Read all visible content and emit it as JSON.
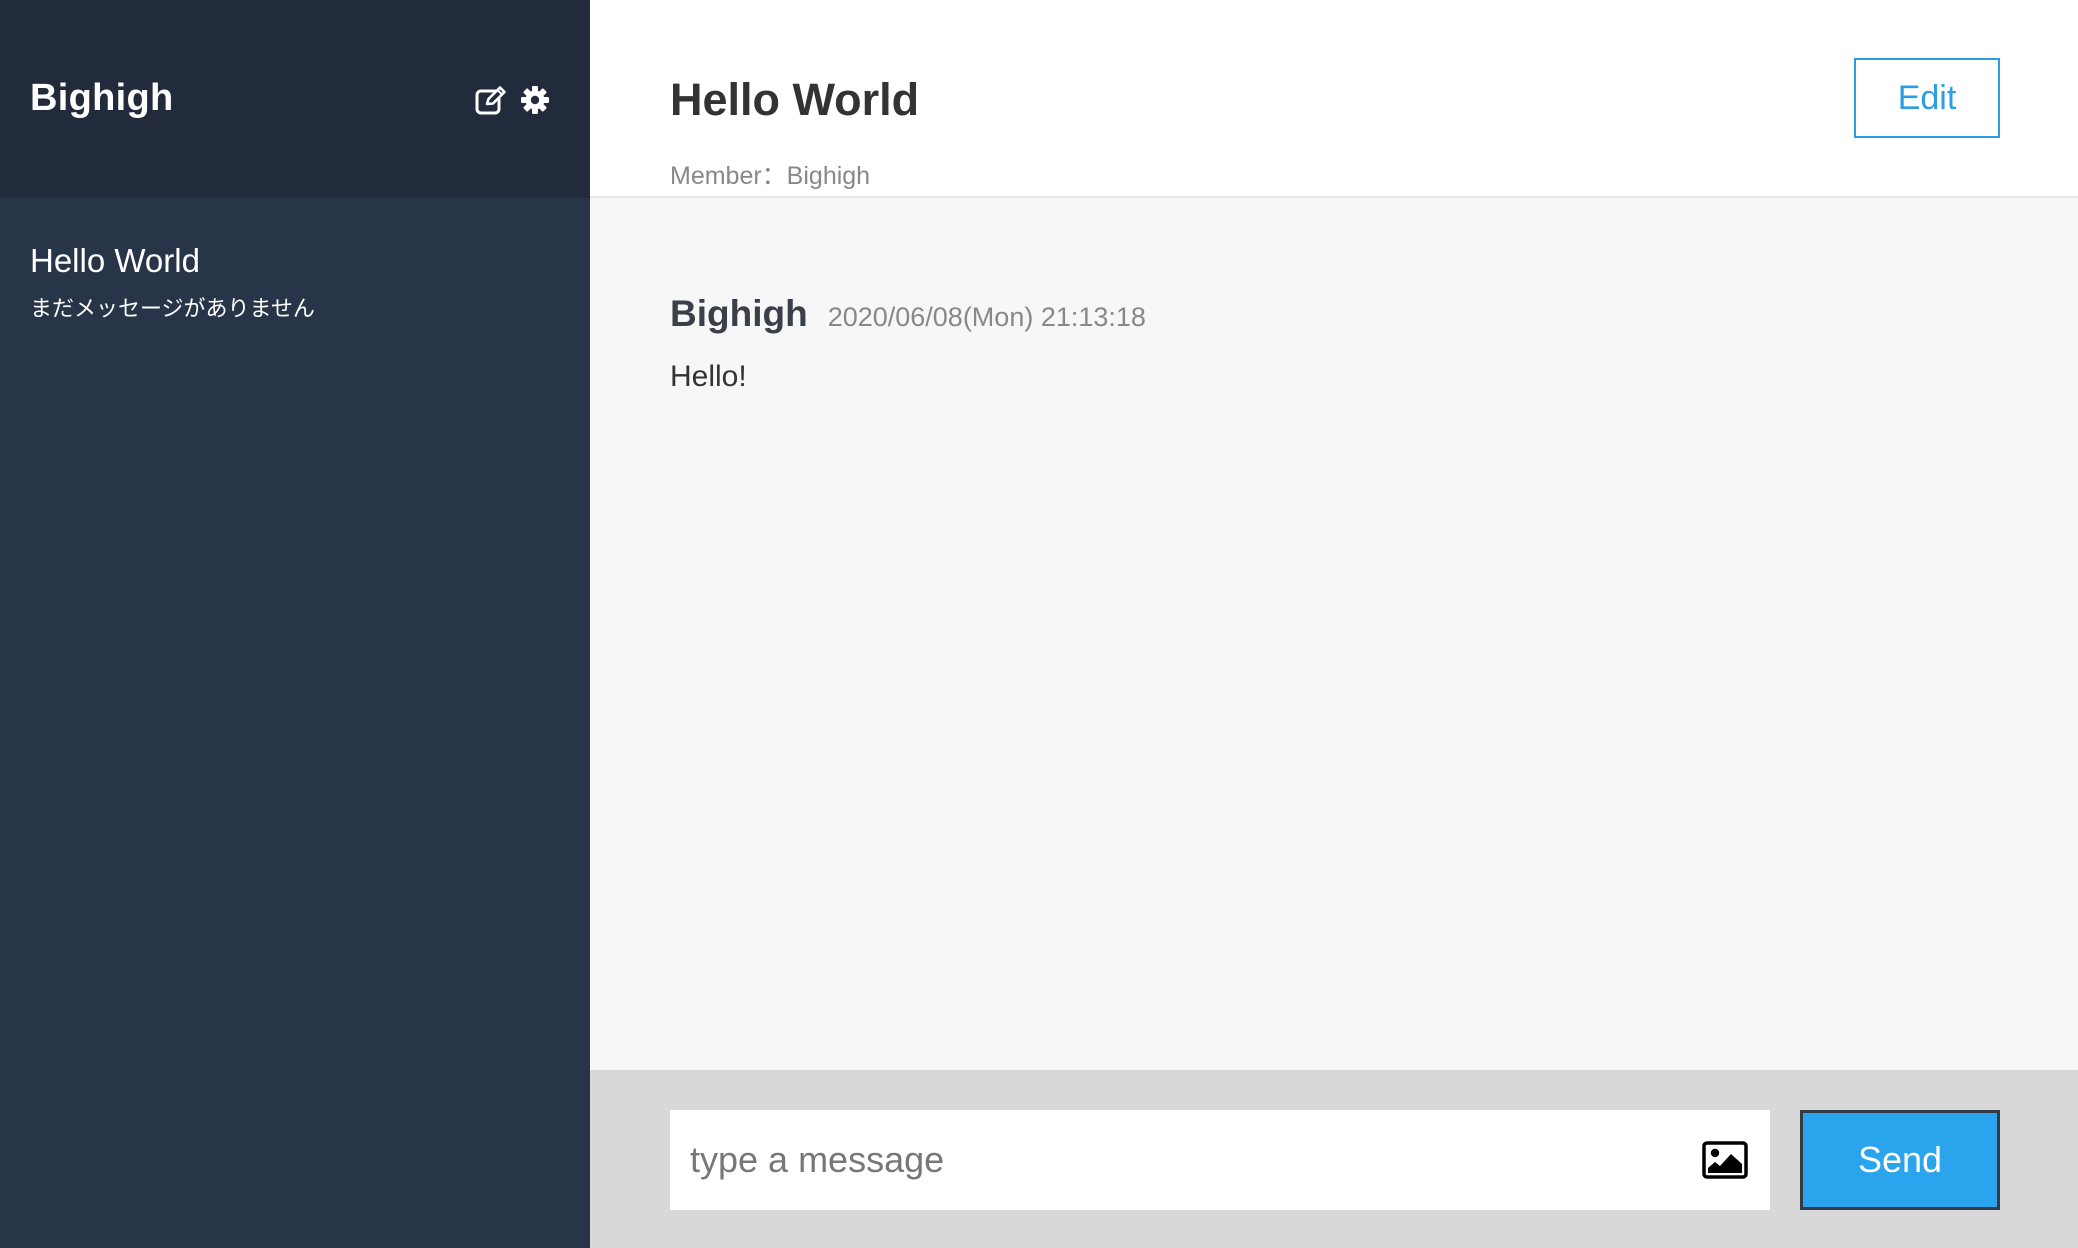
{
  "sidebar": {
    "user_name": "Bighigh",
    "icons": {
      "edit": "edit-icon",
      "settings": "gear-icon"
    },
    "rooms": [
      {
        "name": "Hello World",
        "preview": "まだメッセージがありません"
      }
    ]
  },
  "room": {
    "title": "Hello World",
    "members": "Member：Bighigh",
    "edit_label": "Edit"
  },
  "messages": [
    {
      "author": "Bighigh",
      "time": "2020/06/08(Mon) 21:13:18",
      "text": "Hello!"
    }
  ],
  "composer": {
    "placeholder": "type a message",
    "image_icon": "image-icon",
    "send_label": "Send"
  },
  "colors": {
    "sidebar_bg": "#283548",
    "sidebar_header_bg": "#212b3b",
    "accent": "#2a9ee4",
    "send_bg": "#2aa4ec",
    "messages_bg": "#f7f7f7",
    "composer_bg": "#d8d8d8"
  }
}
